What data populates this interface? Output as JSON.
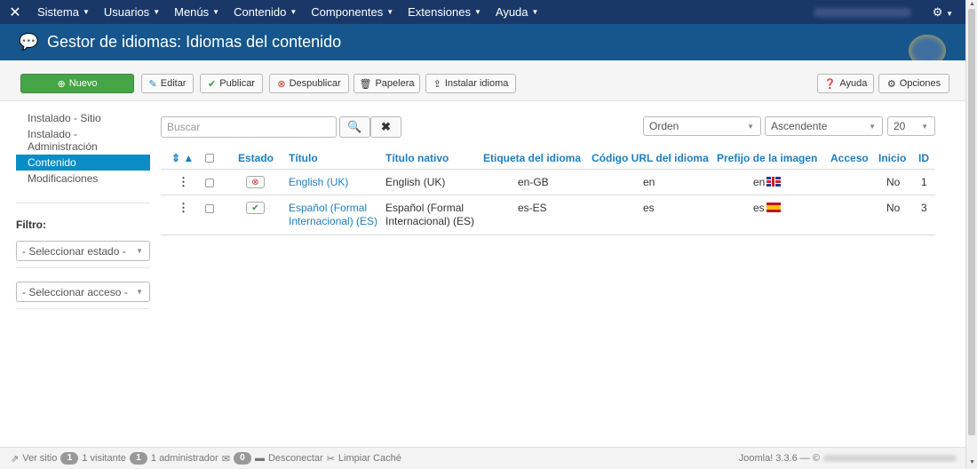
{
  "navbar": {
    "logo_icon": "joomla-icon",
    "menus": [
      {
        "label": "Sistema"
      },
      {
        "label": "Usuarios"
      },
      {
        "label": "Menús"
      },
      {
        "label": "Contenido"
      },
      {
        "label": "Componentes"
      },
      {
        "label": "Extensiones"
      },
      {
        "label": "Ayuda"
      }
    ],
    "settings_icon": "gear-icon"
  },
  "header": {
    "title": "Gestor de idiomas: Idiomas del contenido"
  },
  "toolbar": {
    "new": "Nuevo",
    "edit": "Editar",
    "publish": "Publicar",
    "unpublish": "Despublicar",
    "trash": "Papelera",
    "install": "Instalar idioma",
    "help": "Ayuda",
    "options": "Opciones"
  },
  "sidebar": {
    "items": [
      {
        "label": "Instalado - Sitio",
        "active": false
      },
      {
        "label": "Instalado - Administración",
        "active": false
      },
      {
        "label": "Contenido",
        "active": true
      },
      {
        "label": "Modificaciones",
        "active": false
      }
    ],
    "filter_label": "Filtro:",
    "state_select": "- Seleccionar estado -",
    "access_select": "- Seleccionar acceso -"
  },
  "filters": {
    "search_placeholder": "Buscar",
    "order": "Orden",
    "direction": "Ascendente",
    "limit": "20"
  },
  "table": {
    "headers": {
      "state": "Estado",
      "title": "Título",
      "native": "Título nativo",
      "tag": "Etiqueta del idioma",
      "sef": "Código URL del idioma",
      "image": "Prefijo de la imagen",
      "access": "Acceso",
      "home": "Inicio",
      "id": "ID"
    },
    "rows": [
      {
        "published": false,
        "title": "English (UK)",
        "native": "English (UK)",
        "tag": "en-GB",
        "sef": "en",
        "image": "en",
        "flag": "uk-flag",
        "access": "",
        "home": "No",
        "id": "1"
      },
      {
        "published": true,
        "title": "Español (Formal Internacional) (ES)",
        "native": "Español (Formal Internacional) (ES)",
        "tag": "es-ES",
        "sef": "es",
        "image": "es",
        "flag": "es-flag",
        "access": "",
        "home": "No",
        "id": "3"
      }
    ]
  },
  "statusbar": {
    "view_site": "Ver sitio",
    "visitors_count": "1",
    "visitors_label": "1 visitante",
    "admins_count": "1",
    "admins_label": "1 administrador",
    "messages_count": "0",
    "logout": "Desconectar",
    "clear_cache": "Limpiar Caché",
    "version": "Joomla! 3.3.6 — ©"
  }
}
